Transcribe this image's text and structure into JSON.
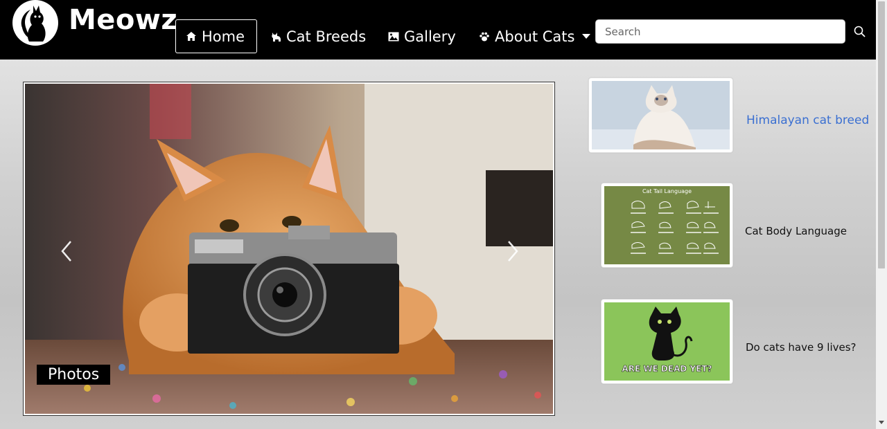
{
  "brand": {
    "name": "Meowz",
    "logo_icon": "cat-silhouette-logo"
  },
  "nav": {
    "items": [
      {
        "label": "Home",
        "icon": "home-icon",
        "active": true
      },
      {
        "label": "Cat Breeds",
        "icon": "cat-icon"
      },
      {
        "label": "Gallery",
        "icon": "image-icon"
      },
      {
        "label": "About Cats",
        "icon": "paw-icon",
        "dropdown": true
      }
    ]
  },
  "search": {
    "placeholder": "Search",
    "value": "",
    "icon": "magnifier-icon"
  },
  "carousel": {
    "caption": "Photos",
    "image": "cat-with-camera-photo",
    "prev_icon": "chevron-left-icon",
    "next_icon": "chevron-right-icon"
  },
  "side": {
    "items": [
      {
        "title": "Himalayan cat breed",
        "image": "white-himalayan-cat-photo",
        "is_link": true
      },
      {
        "title": "Cat Body Language",
        "image": "cat-tail-language-chart",
        "image_heading": "Cat Tail Language"
      },
      {
        "title": "Do cats have 9 lives?",
        "image": "are-we-dead-yet-cat-poster",
        "image_text": "ARE WE DEAD YET?"
      }
    ]
  },
  "colors": {
    "navbar": "#000000",
    "link": "#3a6fd1",
    "caption_bg": "#000000",
    "tail_chart_bg": "#768945",
    "poster_bg": "#8bc55a"
  }
}
